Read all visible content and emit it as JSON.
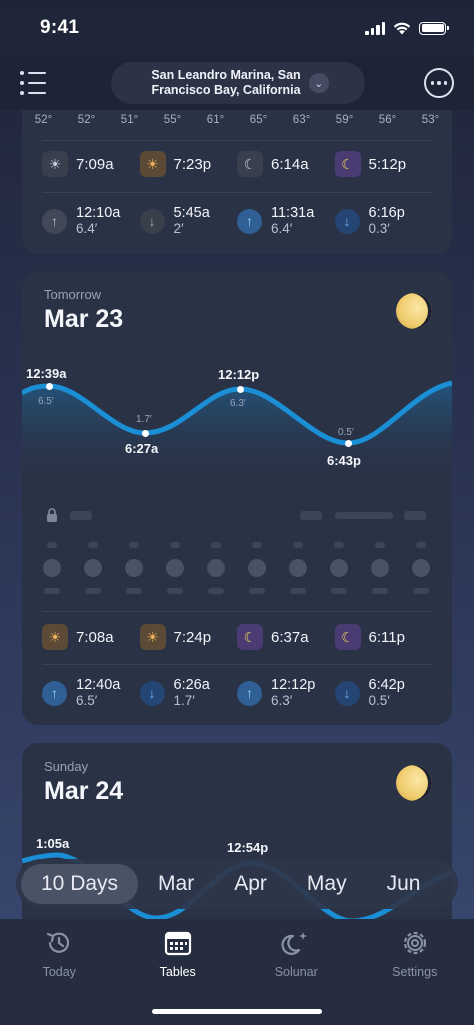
{
  "status_bar": {
    "time": "9:41"
  },
  "header": {
    "location": "San Leandro Marina, San Francisco Bay, California",
    "location_line1": "San Leandro Marina, San",
    "location_line2": "Francisco Bay, California",
    "chevron_icon": "chevron-down-icon",
    "menu_icon": "list-icon",
    "more_icon": "ellipsis-icon"
  },
  "card_prev": {
    "temps": [
      "52°",
      "52°",
      "51°",
      "55°",
      "61°",
      "65°",
      "63°",
      "59°",
      "56°",
      "53°"
    ],
    "sun_moon": [
      {
        "icon": "sunrise-icon",
        "time": "7:09a"
      },
      {
        "icon": "sunset-icon",
        "time": "7:23p"
      },
      {
        "icon": "moonset-icon",
        "time": "6:14a"
      },
      {
        "icon": "moonrise-icon",
        "time": "5:12p"
      }
    ],
    "tides": [
      {
        "dir": "up",
        "time": "12:10a",
        "height": "6.4′"
      },
      {
        "dir": "down",
        "time": "5:45a",
        "height": "2′"
      },
      {
        "dir": "up",
        "time": "11:31a",
        "height": "6.4′"
      },
      {
        "dir": "down",
        "time": "6:16p",
        "height": "0.3′"
      }
    ]
  },
  "card_tomorrow": {
    "day_label": "Tomorrow",
    "date": "Mar 23",
    "moon_icon": "moon-phase-icon",
    "chart_points": [
      {
        "time": "12:39a",
        "height": "6.5′"
      },
      {
        "time": "6:27a",
        "height": "1.7′"
      },
      {
        "time": "12:12p",
        "height": "6.3′"
      },
      {
        "time": "6:43p",
        "height": "0.5′"
      }
    ],
    "sun_moon": [
      {
        "icon": "sunrise-icon",
        "time": "7:08a"
      },
      {
        "icon": "sunset-icon",
        "time": "7:24p"
      },
      {
        "icon": "moonset-icon",
        "time": "6:37a"
      },
      {
        "icon": "moonrise-icon",
        "time": "6:11p"
      }
    ],
    "tides": [
      {
        "dir": "up",
        "time": "12:40a",
        "height": "6.5′"
      },
      {
        "dir": "down",
        "time": "6:26a",
        "height": "1.7′"
      },
      {
        "dir": "up",
        "time": "12:12p",
        "height": "6.3′"
      },
      {
        "dir": "down",
        "time": "6:42p",
        "height": "0.5′"
      }
    ]
  },
  "card_sunday": {
    "day_label": "Sunday",
    "date": "Mar 24",
    "chart_points": [
      {
        "time": "1:05a"
      },
      {
        "time": "12:54p"
      }
    ]
  },
  "period_selector": {
    "items": [
      "10 Days",
      "Mar",
      "Apr",
      "May",
      "Jun"
    ],
    "active": "10 Days"
  },
  "tab_bar": {
    "items": [
      {
        "label": "Today",
        "icon": "today-icon"
      },
      {
        "label": "Tables",
        "icon": "calendar-icon"
      },
      {
        "label": "Solunar",
        "icon": "solunar-moon-icon"
      },
      {
        "label": "Settings",
        "icon": "gear-icon"
      }
    ],
    "active": "Tables"
  },
  "colors": {
    "tide_wave": "#1a8fd6",
    "accent_up": "#8fd0ff",
    "accent_down": "#5fb4ff",
    "sun_accent": "#f0b45a",
    "moon_accent": "#f2d35a"
  }
}
